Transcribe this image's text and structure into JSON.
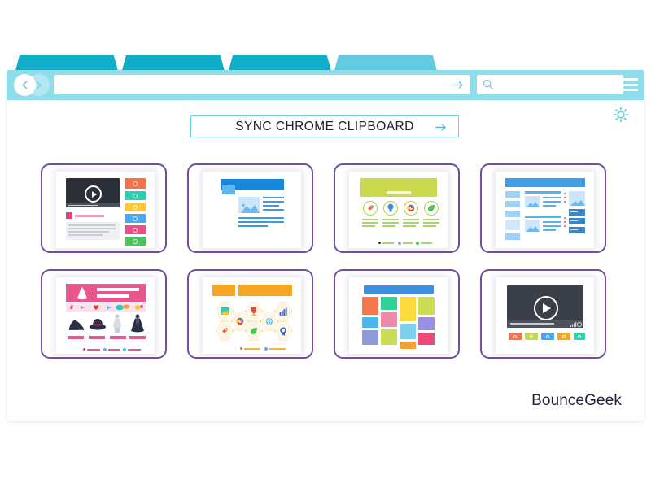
{
  "window": {
    "title": "Browser Window Mockup",
    "tabs": [
      {
        "name": "tab-1",
        "active": false,
        "color": "#11aecb"
      },
      {
        "name": "tab-2",
        "active": false,
        "color": "#0fabc9"
      },
      {
        "name": "tab-3",
        "active": false,
        "color": "#11aecb"
      },
      {
        "name": "tab-4",
        "active": true,
        "color": "#63cbe0"
      }
    ],
    "chrome_color": "#8fdcea",
    "nav": {
      "back_icon": "chevron-left-icon",
      "forward_icon": "chevron-right-icon",
      "url_value": "",
      "url_placeholder": "",
      "go_icon": "arrow-right-icon",
      "search_value": "",
      "search_placeholder": "",
      "search_icon": "search-icon",
      "menu_icon": "hamburger-menu-icon"
    },
    "settings_icon": "gear-icon",
    "settings_color": "#6fd0dd"
  },
  "sync_button": {
    "label": "SYNC CHROME CLIPBOARD",
    "arrow_icon": "arrow-right-icon",
    "border_color": "#6fd0dd",
    "text_color": "#20203a"
  },
  "brand": {
    "name": "BounceGeek",
    "color": "#20203a"
  },
  "cards": [
    {
      "id": "card-video-sidebar",
      "name": "video-page-thumbnail",
      "type": "video-with-color-tiles",
      "accent": "#2b2f38",
      "play_icon": "play-icon",
      "tile_colors": [
        "#f2744a",
        "#2ecfb0",
        "#ffc832",
        "#4aa8f0",
        "#ea4f8c",
        "#4cc45c"
      ],
      "text_line_color": "#c9ccd4",
      "title_swatch": "#e0457b"
    },
    {
      "id": "card-article",
      "name": "article-page-thumbnail",
      "type": "article-layout",
      "accent": "#1a86d8",
      "secondary": "#5fb6ef",
      "image_icon": "mountain-image-icon",
      "line_color": "#3d9ae0"
    },
    {
      "id": "card-features",
      "name": "feature-icons-page-thumbnail",
      "type": "feature-icons",
      "accent": "#cbd94e",
      "icons": [
        "rocket-icon",
        "lightbulb-icon",
        "camera-icon",
        "leaf-icon"
      ],
      "icon_colors": [
        "#e8664a",
        "#3a8fd8",
        "#e34a3a",
        "#4cc45c"
      ],
      "ring_color": "#b9cf3c",
      "line_color": "#a8d46a"
    },
    {
      "id": "card-dashboard",
      "name": "dashboard-page-thumbnail",
      "type": "magazine-layout",
      "accent": "#3c9fe8",
      "secondary": "#9ed2f5",
      "line_color": "#5ab0ec",
      "image_icon": "mountain-image-icon"
    },
    {
      "id": "card-shop",
      "name": "fashion-shop-thumbnail",
      "type": "ecommerce-fashion",
      "accent": "#e8568e",
      "items": [
        "shoe-icon",
        "hat-icon",
        "dress-icon",
        "gown-icon"
      ],
      "price_color": "#e8568e",
      "heart_icon": "heart-icon"
    },
    {
      "id": "card-hexicons",
      "name": "hexagon-icons-thumbnail",
      "type": "hexagon-icon-grid",
      "accent": "#f5a623",
      "hex_border": "#f0b640",
      "icons": [
        "image-icon",
        "camera-icon",
        "cup-icon",
        "globe-icon",
        "chart-icon",
        "rocket-icon",
        "leaf-icon",
        "badge-icon"
      ]
    },
    {
      "id": "card-masonry",
      "name": "color-grid-thumbnail",
      "type": "masonry-color-grid",
      "accent": "#3d8fe0",
      "tile_colors": [
        "#f4784e",
        "#2fd39a",
        "#fada3c",
        "#ccdd55",
        "#4ab8ee",
        "#f08aa8",
        "#9a8fe0",
        "#8f9ad8",
        "#cbdd55",
        "#7fd0f0",
        "#f2a03c",
        "#ee4a78"
      ]
    },
    {
      "id": "card-video-player",
      "name": "video-player-thumbnail",
      "type": "video-player",
      "accent": "#3a3f48",
      "play_icon": "play-icon",
      "button_colors": [
        "#f2744a",
        "#c8d84c",
        "#4aa8f0",
        "#f5a623",
        "#2ecfb0"
      ]
    }
  ]
}
